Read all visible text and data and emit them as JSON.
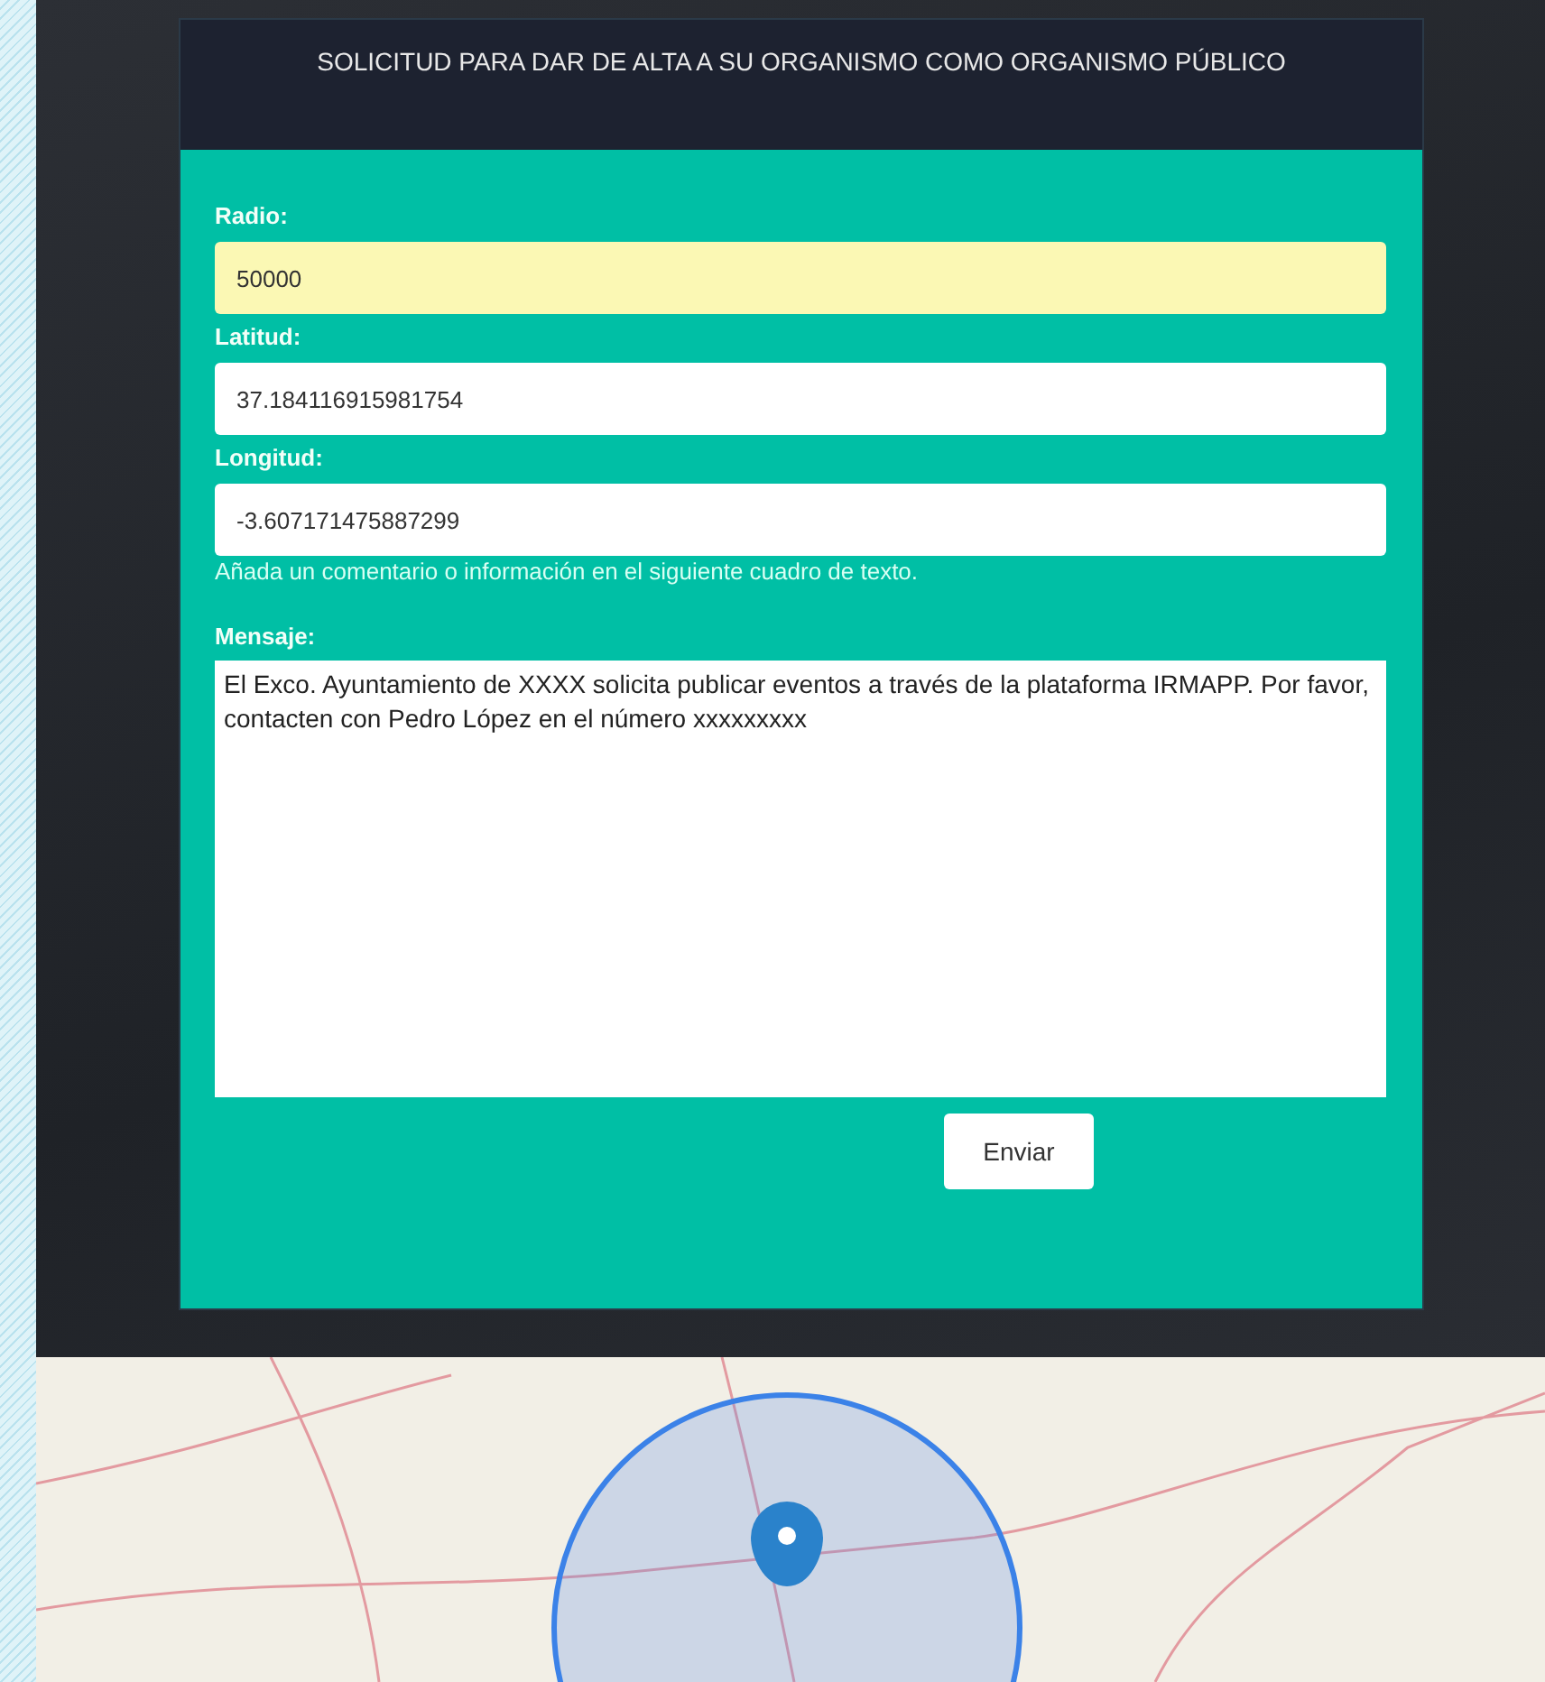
{
  "form": {
    "title": "SOLICITUD PARA DAR DE ALTA A SU ORGANISMO COMO ORGANISMO PÚBLICO",
    "fields": [
      {
        "label": "Radio:",
        "value": "50000",
        "highlighted": true
      },
      {
        "label": "Latitud:",
        "value": "37.184116915981754",
        "highlighted": false
      },
      {
        "label": "Longitud:",
        "value": "-3.607171475887299",
        "highlighted": false
      }
    ],
    "hint": "Añada un comentario o información en el siguiente cuadro de texto.",
    "message_label": "Mensaje:",
    "message": "El Exco. Ayuntamiento de XXXX solicita publicar eventos a través de la plataforma IRMAPP. Por favor, contacten con Pedro López en el número xxxxxxxxx",
    "submit": "Enviar"
  }
}
